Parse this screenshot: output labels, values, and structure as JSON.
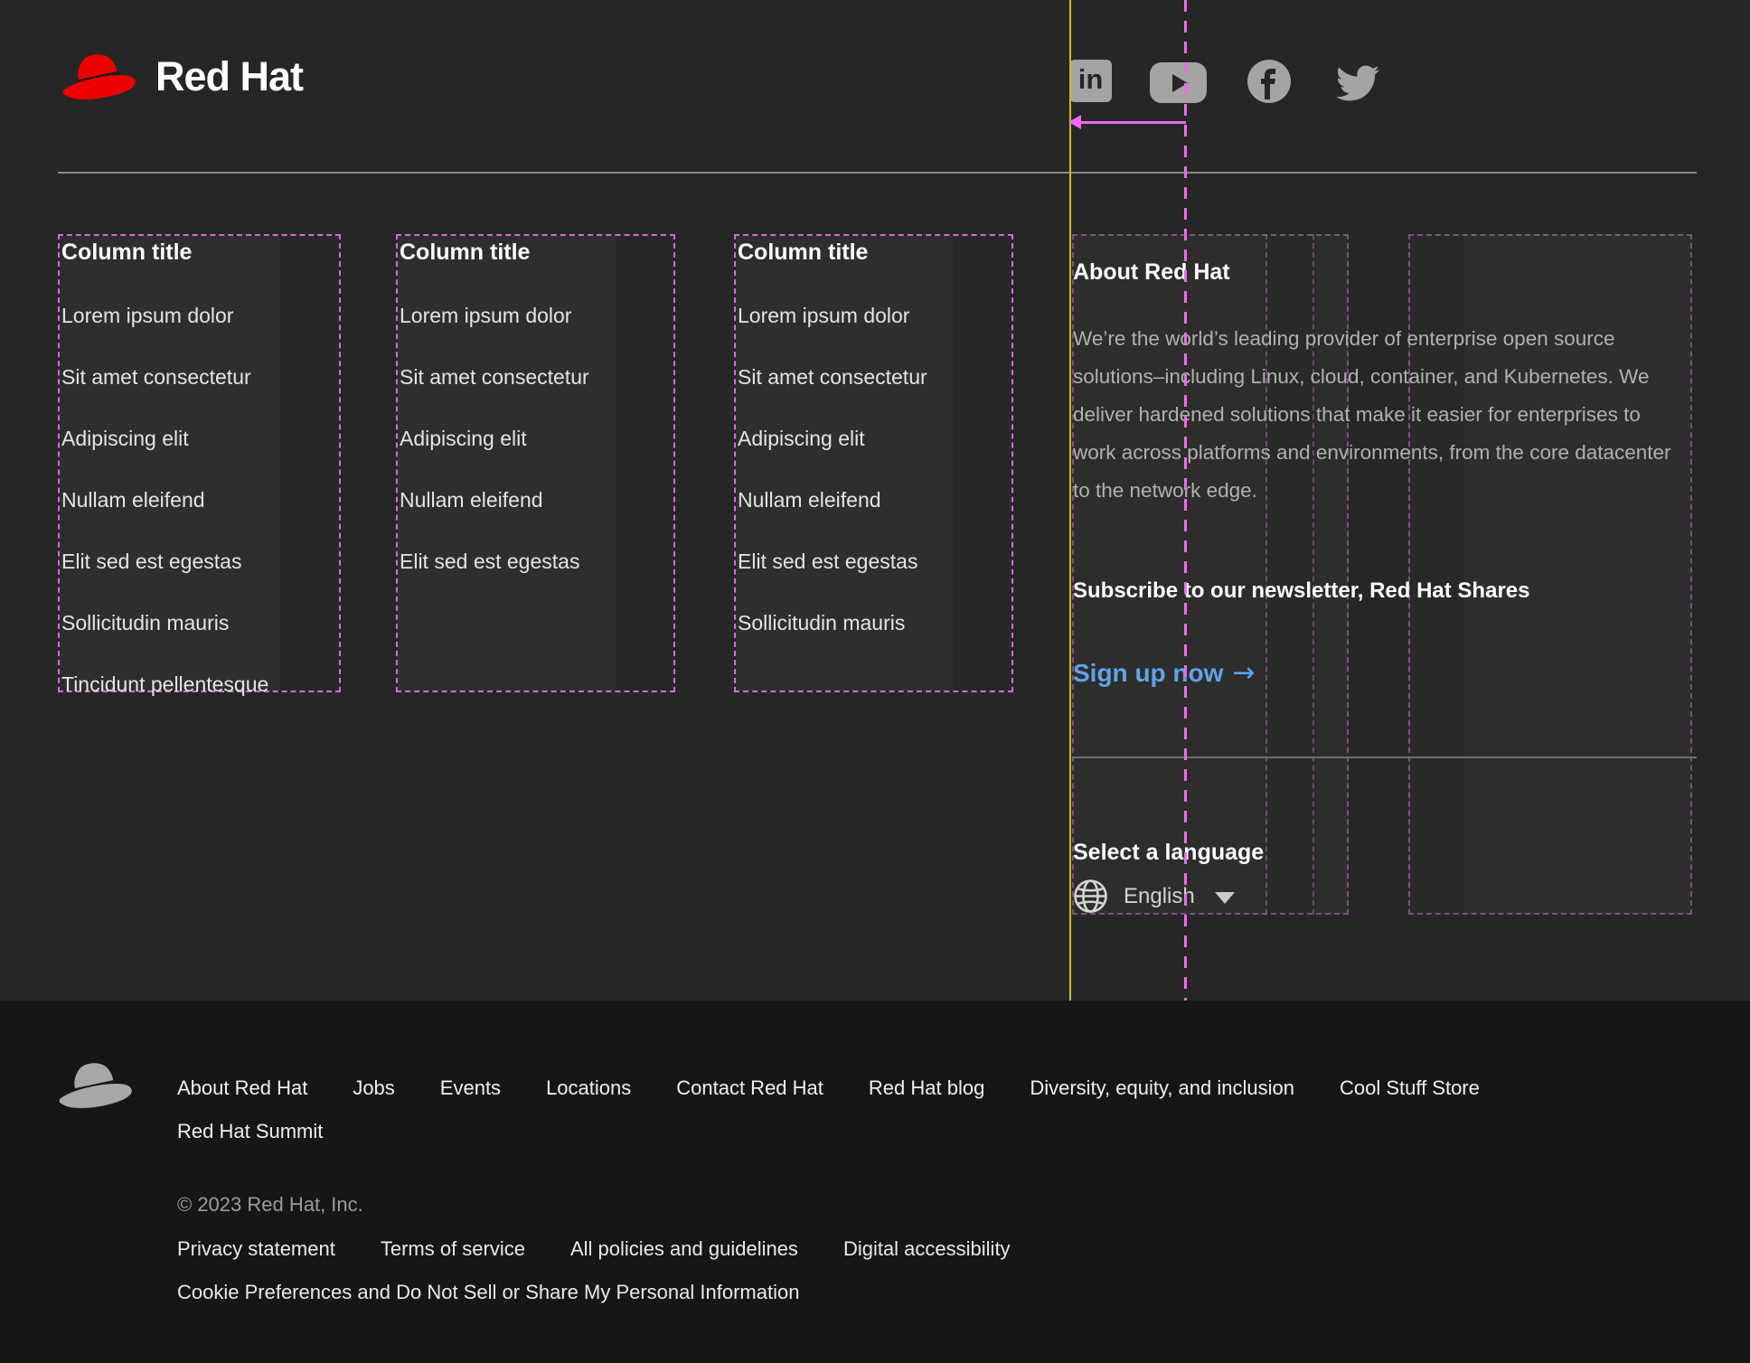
{
  "header": {
    "brand": "Red Hat",
    "social": [
      {
        "label": "LinkedIn"
      },
      {
        "label": "YouTube"
      },
      {
        "label": "Facebook"
      },
      {
        "label": "Twitter"
      }
    ]
  },
  "columns": [
    {
      "title": "Column title",
      "links": [
        "Lorem ipsum dolor",
        "Sit amet consectetur",
        "Adipiscing elit",
        "Nullam eleifend",
        "Elit sed est egestas",
        "Sollicitudin mauris",
        "Tincidunt pellentesque"
      ]
    },
    {
      "title": "Column title",
      "links": [
        "Lorem ipsum dolor",
        "Sit amet consectetur",
        "Adipiscing elit",
        "Nullam eleifend",
        "Elit sed est egestas"
      ]
    },
    {
      "title": "Column title",
      "links": [
        "Lorem ipsum dolor",
        "Sit amet consectetur",
        "Adipiscing elit",
        "Nullam eleifend",
        "Elit sed est egestas",
        "Sollicitudin mauris"
      ]
    }
  ],
  "about": {
    "title": "About Red Hat",
    "body": "We’re the world’s leading provider of enterprise open source solutions–including Linux, cloud, container, and Kubernetes. We deliver hardened solutions that make it easier for enterprises to work across platforms and environments, from the core datacenter to the network edge.",
    "subscribe": "Subscribe to our newsletter, Red Hat Shares",
    "signup": "Sign up now",
    "signup_arrow": "→"
  },
  "language": {
    "title": "Select a language",
    "current": "English"
  },
  "footer": {
    "nav": [
      "About Red Hat",
      "Jobs",
      "Events",
      "Locations",
      "Contact Red Hat",
      "Red Hat blog",
      "Diversity, equity, and inclusion",
      "Cool Stuff Store",
      "Red Hat Summit"
    ],
    "copyright": "© 2023 Red Hat, Inc.",
    "legal": [
      "Privacy statement",
      "Terms of service",
      "All policies and guidelines",
      "Digital accessibility"
    ],
    "cookie": "Cookie Preferences and Do Not Sell or Share My Personal Information"
  },
  "colors": {
    "background": "#262626",
    "footer_background": "#161616",
    "link_blue": "#61a3e9",
    "annotation_pink": "#ef6af0",
    "annotation_purple_dash": "#cf6fd8",
    "annotation_yellow": "#c9c21f",
    "icon_gray": "#a4a4a4"
  }
}
